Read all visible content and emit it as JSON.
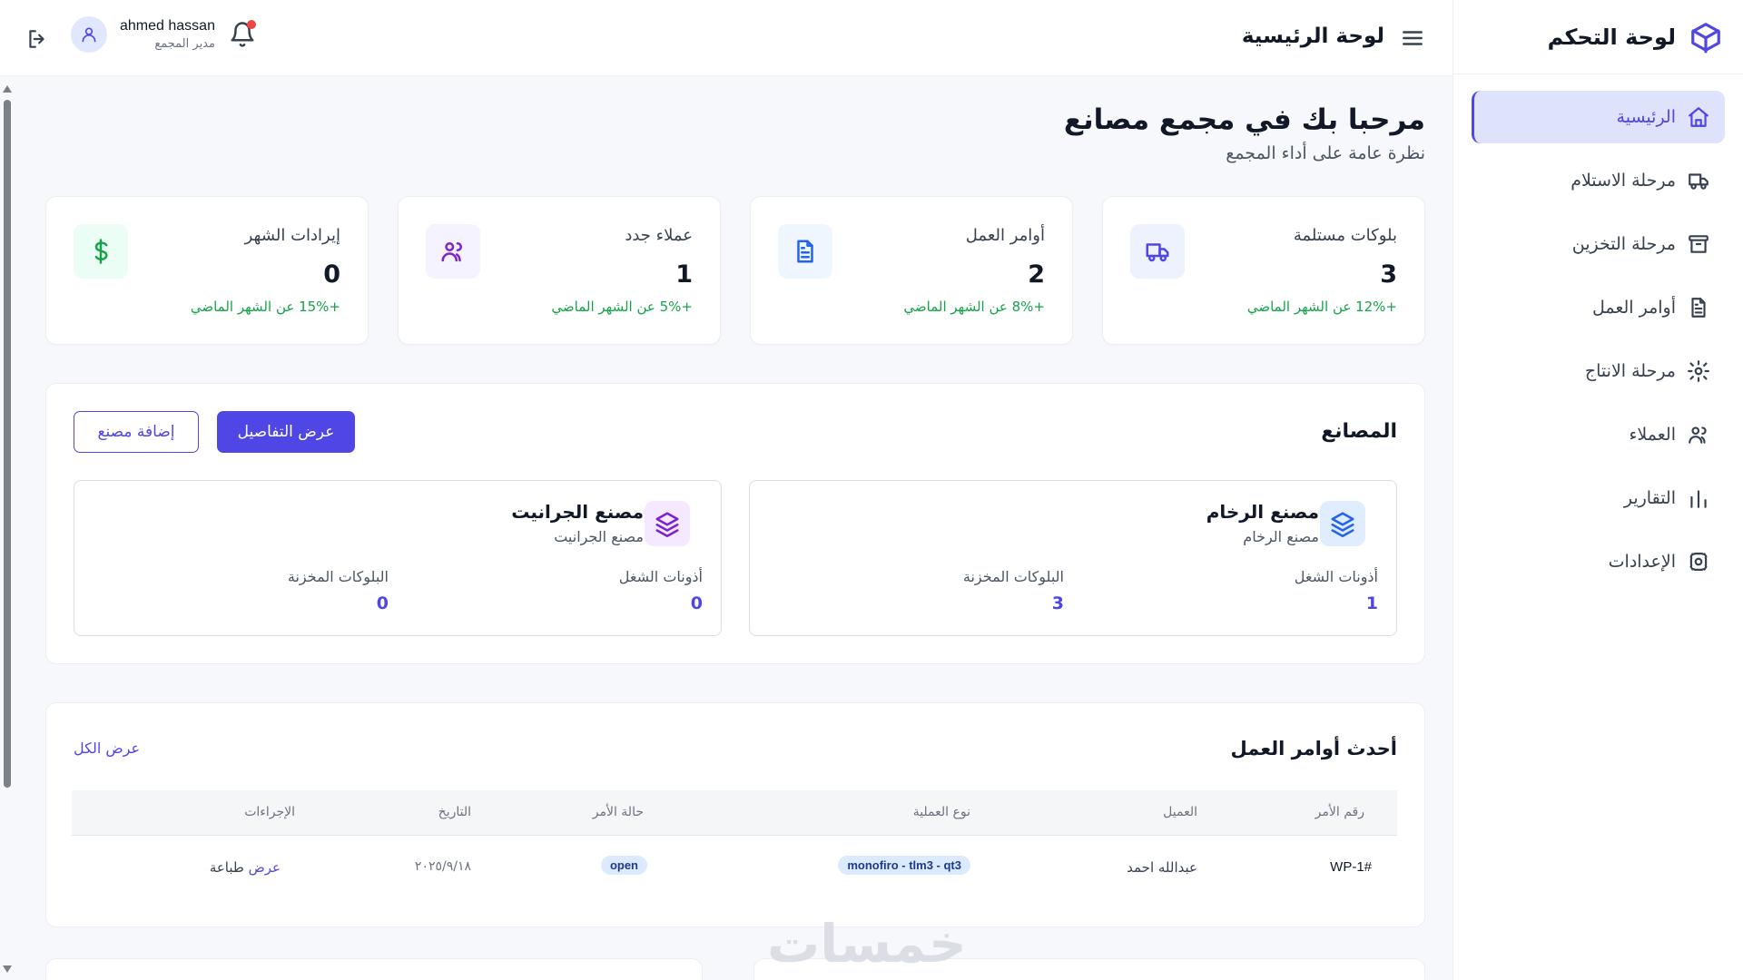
{
  "sidebar": {
    "title": "لوحة التحكم",
    "brand_icon": "cube-icon",
    "items": [
      {
        "label": "الرئيسية",
        "icon": "home-icon",
        "active": true
      },
      {
        "label": "مرحلة الاستلام",
        "icon": "truck-icon"
      },
      {
        "label": "مرحلة التخزين",
        "icon": "archive-icon"
      },
      {
        "label": "أوامر العمل",
        "icon": "document-icon"
      },
      {
        "label": "مرحلة الانتاج",
        "icon": "gear-icon"
      },
      {
        "label": "العملاء",
        "icon": "users-icon"
      },
      {
        "label": "التقارير",
        "icon": "bar-chart-icon"
      },
      {
        "label": "الإعدادات",
        "icon": "settings-icon"
      }
    ]
  },
  "topbar": {
    "title": "لوحة الرئيسية",
    "user": {
      "name": "ahmed hassan",
      "role": "مدير المجمع"
    }
  },
  "welcome": {
    "title": "مرحبا بك في مجمع مصانع",
    "subtitle": "نظرة عامة على أداء المجمع"
  },
  "stats": [
    {
      "label": "بلوكات مستلمة",
      "value": "3",
      "change": "+12% عن الشهر الماضي",
      "icon": "truck-icon",
      "color": "#4f46e5",
      "bg": "#eef2ff"
    },
    {
      "label": "أوامر العمل",
      "value": "2",
      "change": "+8% عن الشهر الماضي",
      "icon": "document-icon",
      "color": "#2563eb",
      "bg": "#eff6ff"
    },
    {
      "label": "عملاء جدد",
      "value": "1",
      "change": "+5% عن الشهر الماضي",
      "icon": "users-icon",
      "color": "#7e22ce",
      "bg": "#f5f3ff"
    },
    {
      "label": "إيرادات الشهر",
      "value": "0",
      "change": "+15% عن الشهر الماضي",
      "icon": "dollar-icon",
      "color": "#16a34a",
      "bg": "#ecfdf5"
    }
  ],
  "factories": {
    "title": "المصانع",
    "view_button": "عرض التفاصيل",
    "add_button": "إضافة مصنع",
    "cards": [
      {
        "title": "مصنع الرخام",
        "subtitle": "مصنع الرخام",
        "metric1_label": "أذونات الشغل",
        "metric1_value": "1",
        "metric2_label": "البلوكات المخزنة",
        "metric2_value": "3",
        "icon_color": "#2563eb",
        "icon_bg": "#e0ecff"
      },
      {
        "title": "مصنع الجرانيت",
        "subtitle": "مصنع الجرانيت",
        "metric1_label": "أذونات الشغل",
        "metric1_value": "0",
        "metric2_label": "البلوكات المخزنة",
        "metric2_value": "0",
        "icon_color": "#7e22ce",
        "icon_bg": "#f4e9ff"
      }
    ]
  },
  "orders": {
    "title": "أحدث أوامر العمل",
    "view_all": "عرض الكل",
    "columns": [
      "رقم الأمر",
      "العميل",
      "نوع العملية",
      "حالة الأمر",
      "التاريخ",
      "الإجراءات"
    ],
    "rows": [
      {
        "order_no": "WP-1#",
        "client": "عبدالله احمد",
        "operation": "monofiro - tlm3 - qt3",
        "status": "open",
        "date": "٢٠٢٥/٩/١٨",
        "action_view": "عرض",
        "action_print": "طباعة"
      }
    ]
  },
  "watermark": "خمسات"
}
